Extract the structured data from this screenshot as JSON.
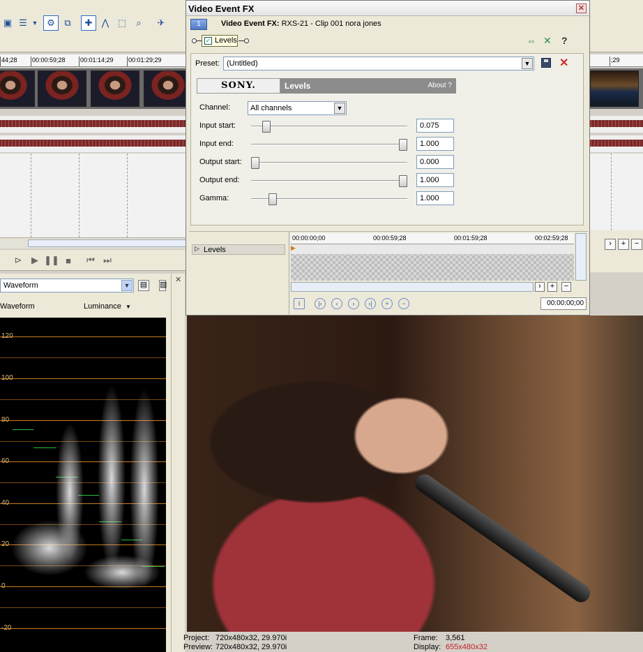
{
  "timeline": {
    "ruler_ticks": [
      "44;28",
      "00:00:59;28",
      "00:01:14;29",
      "00:01:29;29",
      ";29"
    ]
  },
  "scope": {
    "mode_select": "Waveform",
    "header_left": "Waveform",
    "header_right": "Luminance",
    "y_labels": [
      "120",
      "100",
      "80",
      "60",
      "40",
      "20",
      "0",
      "-20"
    ]
  },
  "status": {
    "project_label": "Project:",
    "project_value": "720x480x32, 29.970i",
    "preview_label": "Preview:",
    "preview_value": "720x480x32, 29.970i",
    "frame_label": "Frame:",
    "frame_value": "3,561",
    "display_label": "Display:",
    "display_value": "655x480x32",
    "display_color": "#c0202a"
  },
  "dialog": {
    "title": "Video Event FX",
    "chain_number": "1",
    "chain_title_bold": "Video Event FX:",
    "chain_title_rest": " RXS-21 - Clip 001 nora jones",
    "plugin_chip": "Levels",
    "preset_label": "Preset:",
    "preset_value": "(Untitled)",
    "banner_brand": "SONY.",
    "banner_title": "Levels",
    "banner_about": "About  ?",
    "channel_label": "Channel:",
    "channel_value": "All channels",
    "params": [
      {
        "label": "Input start:",
        "value": "0.075",
        "fraction": 0.075
      },
      {
        "label": "Input end:",
        "value": "1.000",
        "fraction": 1.0
      },
      {
        "label": "Output start:",
        "value": "0.000",
        "fraction": 0.0
      },
      {
        "label": "Output end:",
        "value": "1.000",
        "fraction": 1.0
      },
      {
        "label": "Gamma:",
        "value": "1.000",
        "fraction": 0.12
      }
    ],
    "keyframe": {
      "track_label": "Levels",
      "ruler": [
        "00:00:00;00",
        "00:00:59;28",
        "00:01:59;28",
        "00:02:59;28"
      ],
      "time": "00:00:00;00"
    }
  }
}
